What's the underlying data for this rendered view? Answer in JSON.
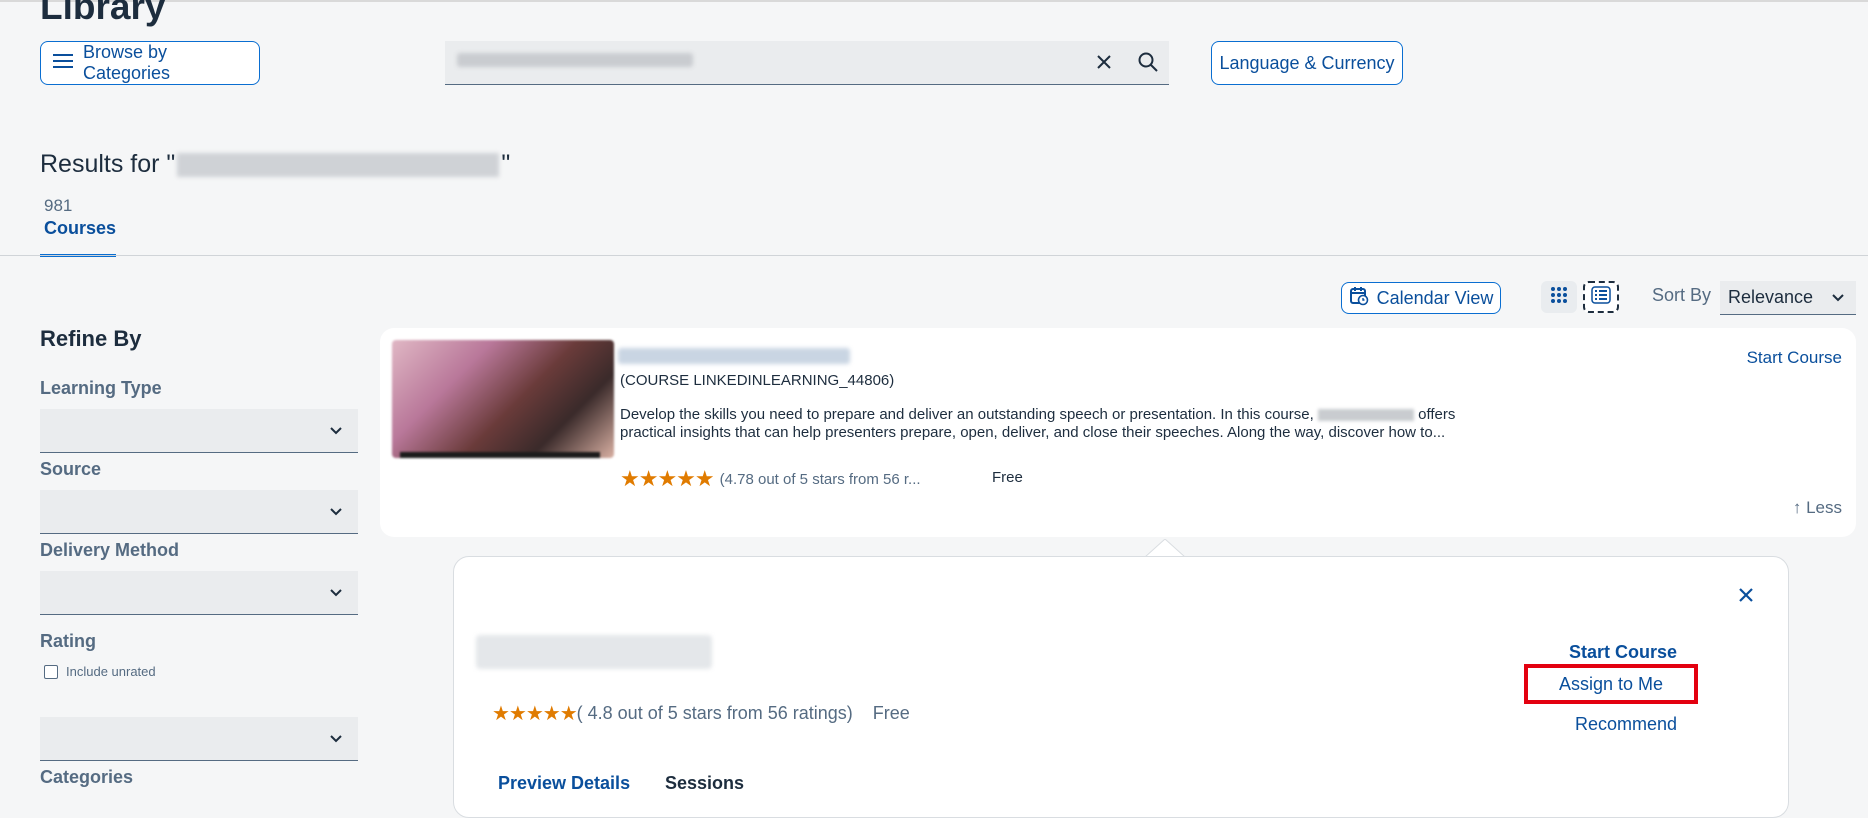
{
  "header": {
    "title": "Library",
    "browse_label": "Browse by Categories",
    "language_label": "Language & Currency"
  },
  "results": {
    "prefix": "Results for \"",
    "suffix": "\"",
    "tab_count": "981",
    "tab_label": "Courses"
  },
  "toolbar": {
    "calendar_label": "Calendar View",
    "sort_label": "Sort By",
    "sort_value": "Relevance"
  },
  "refine": {
    "title": "Refine By",
    "learning_type": "Learning Type",
    "source": "Source",
    "delivery_method": "Delivery Method",
    "rating": "Rating",
    "include_unrated": "Include unrated",
    "categories": "Categories"
  },
  "course": {
    "code": "(COURSE LINKEDINLEARNING_44806)",
    "desc_part1": "Develop the skills you need to prepare and deliver an outstanding speech or presentation. In this course, ",
    "desc_part2": " offers practical insights that can help presenters prepare, open, deliver, and close their speeches. Along the way, discover how to...",
    "rating_stars": "★★★★★",
    "rating_text": "(4.78 out of 5 stars from 56 r...",
    "price": "Free",
    "start_label": "Start Course",
    "less_label": "↑ Less"
  },
  "detail": {
    "rating_stars": "★★★★★",
    "rating_text": "( 4.8 out of 5 stars from 56 ratings)",
    "price": "Free",
    "start_label": "Start Course",
    "assign_label": "Assign to Me",
    "recommend_label": "Recommend",
    "tabs": [
      "Preview Details",
      "Sessions"
    ]
  },
  "colors": {
    "accent": "#0a6ed1",
    "link": "#0a4f9c",
    "star": "#e07b00",
    "highlight": "#e3000f"
  },
  "icons": [
    "menu-icon",
    "clear-icon",
    "search-icon",
    "calendar-icon",
    "grid-icon",
    "list-icon",
    "chevron-down-icon",
    "close-icon"
  ]
}
